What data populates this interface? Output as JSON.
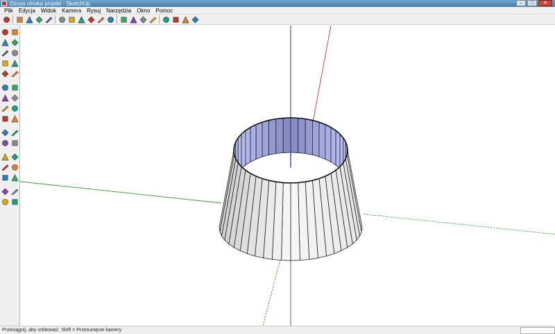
{
  "window": {
    "title": "Dzoya olnvka projekt - SketchUp",
    "controls": [
      "minimize",
      "maximize",
      "close"
    ]
  },
  "menu": [
    {
      "label": "Plik"
    },
    {
      "label": "Edycja"
    },
    {
      "label": "Widok"
    },
    {
      "label": "Kamera"
    },
    {
      "label": "Rysuj"
    },
    {
      "label": "Narzędzia"
    },
    {
      "label": "Okno"
    },
    {
      "label": "Pomoc"
    }
  ],
  "toolbar_icons": [
    "select-icon",
    "pencil-icon",
    "rectangle-icon",
    "circle-icon",
    "arc-icon",
    "eraser-icon",
    "paint-bucket-icon",
    "push-pull-icon",
    "move-icon",
    "rotate-icon",
    "offset-icon",
    "orbit-icon",
    "pan-icon",
    "zoom-icon",
    "zoom-extents-icon",
    "add-location-icon",
    "toggle-terrain-icon",
    "get-models-icon",
    "share-model-icon"
  ],
  "sidebar_icons": [
    [
      "select-icon",
      "eraser-icon"
    ],
    [
      "paint-bucket-icon",
      "component-icon"
    ],
    [
      "rectangle-icon",
      "line-icon"
    ],
    [
      "circle-icon",
      "arc-icon"
    ],
    [
      "polygon-icon",
      "freehand-icon"
    ],
    [
      "move-icon",
      "push-pull-icon"
    ],
    [
      "rotate-icon",
      "follow-me-icon"
    ],
    [
      "scale-icon",
      "offset-icon"
    ],
    [
      "tape-measure-icon",
      "dimension-icon"
    ],
    [
      "protractor-icon",
      "text-icon"
    ],
    [
      "axes-icon",
      "3d-text-icon"
    ],
    [
      "orbit-icon",
      "pan-icon"
    ],
    [
      "zoom-icon",
      "zoom-window-icon"
    ],
    [
      "zoom-extents-icon",
      "previous-view-icon"
    ],
    [
      "position-camera-icon",
      "look-around-icon"
    ],
    [
      "walk-icon",
      "section-plane-icon"
    ]
  ],
  "status": {
    "text": "Przeciągnij, aby orbitować. Shift = Przesunięcie kamery"
  },
  "colors": {
    "title_bar": "#4b7da8",
    "axis_red": "#c0392b",
    "axis_green": "#2e9a2e",
    "axis_blue": "#2a2a2a",
    "inner_face": "#a8aed4",
    "outer_face": "#f7f7f7"
  }
}
